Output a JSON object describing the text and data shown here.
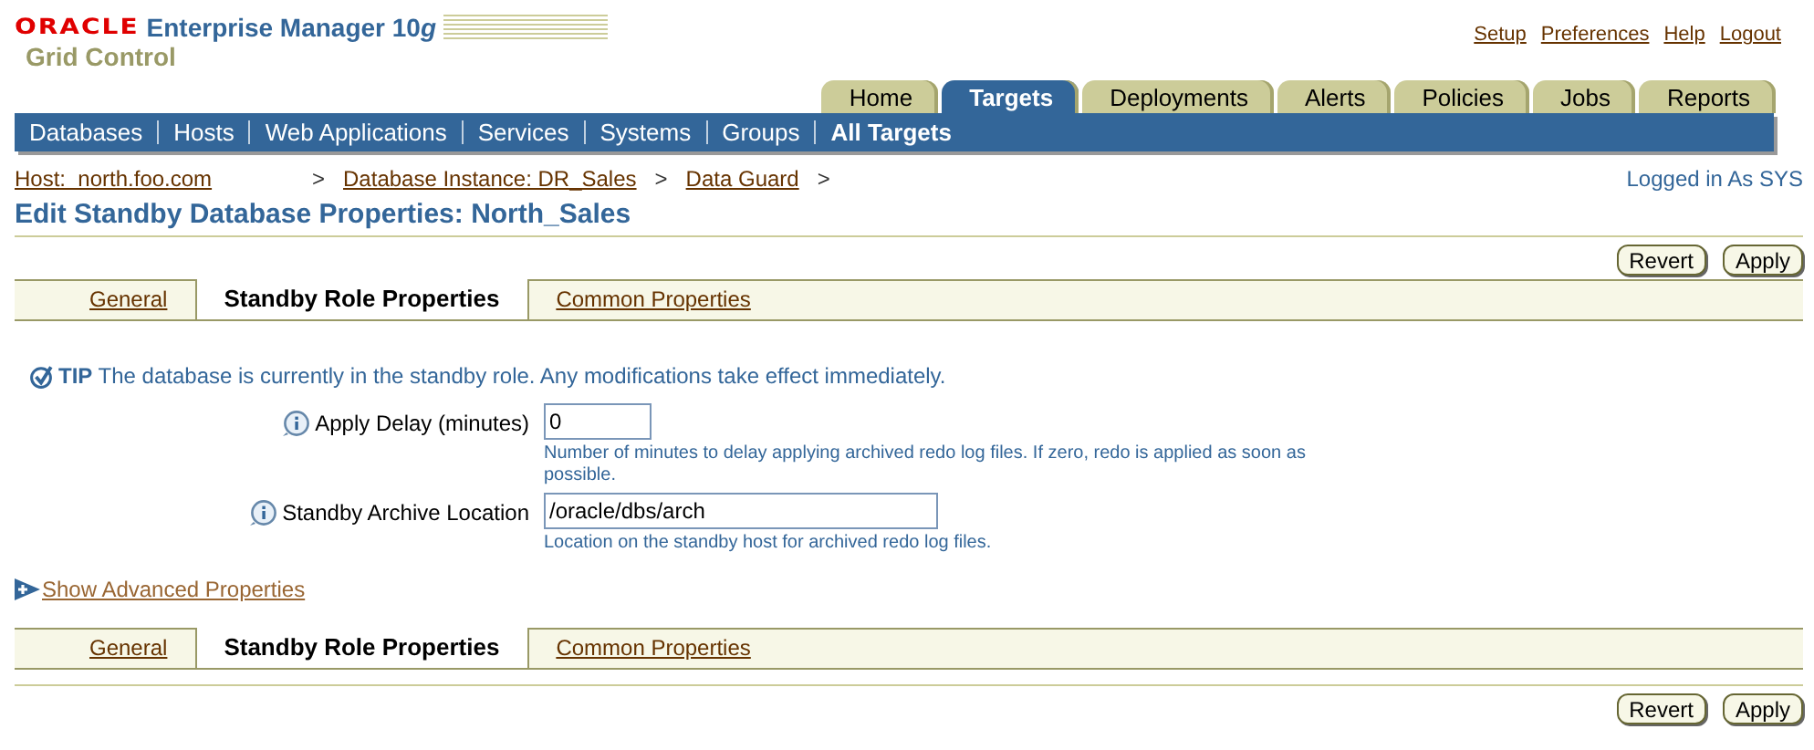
{
  "brand": {
    "company": "ORACLE",
    "product": "Enterprise Manager 10",
    "version_suffix": "g",
    "edition": "Grid Control"
  },
  "global_links": [
    "Setup",
    "Preferences",
    "Help",
    "Logout"
  ],
  "tabs": [
    {
      "label": "Home",
      "selected": false
    },
    {
      "label": "Targets",
      "selected": true
    },
    {
      "label": "Deployments",
      "selected": false
    },
    {
      "label": "Alerts",
      "selected": false
    },
    {
      "label": "Policies",
      "selected": false
    },
    {
      "label": "Jobs",
      "selected": false
    },
    {
      "label": "Reports",
      "selected": false
    }
  ],
  "subnav": [
    {
      "label": "Databases",
      "selected": false
    },
    {
      "label": "Hosts",
      "selected": false
    },
    {
      "label": "Web Applications",
      "selected": false
    },
    {
      "label": "Services",
      "selected": false
    },
    {
      "label": "Systems",
      "selected": false
    },
    {
      "label": "Groups",
      "selected": false
    },
    {
      "label": "All Targets",
      "selected": true
    }
  ],
  "breadcrumbs": [
    "Host:  north.foo.com",
    "Database Instance: DR_Sales",
    "Data Guard"
  ],
  "breadcrumb_separator": ">",
  "logged_in": "Logged in As SYS",
  "page_title": "Edit Standby Database Properties: North_Sales",
  "top_buttons": [
    "Revert",
    "Apply"
  ],
  "top_subtabs": [
    {
      "label": "General",
      "selected": false
    },
    {
      "label": "Standby Role Properties",
      "selected": true
    },
    {
      "label": "Common Properties",
      "selected": false
    }
  ],
  "tip": {
    "label": "TIP",
    "text": "The database is currently in the standby role. Any modifications take effect immediately."
  },
  "fields": [
    {
      "label": "Apply Delay (minutes)",
      "value": "0",
      "help": "Number of minutes to delay applying archived redo log files. If zero, redo is applied as soon as possible."
    },
    {
      "label": "Standby Archive Location",
      "value": "/oracle/dbs/arch",
      "help": "Location on the standby host for archived redo log files."
    }
  ],
  "advanced_link": "Show Advanced Properties",
  "bottom_subtabs": [
    {
      "label": "General",
      "selected": false
    },
    {
      "label": "Standby Role Properties",
      "selected": true
    },
    {
      "label": "Common Properties",
      "selected": false
    }
  ],
  "bottom_buttons": [
    "Revert",
    "Apply"
  ]
}
